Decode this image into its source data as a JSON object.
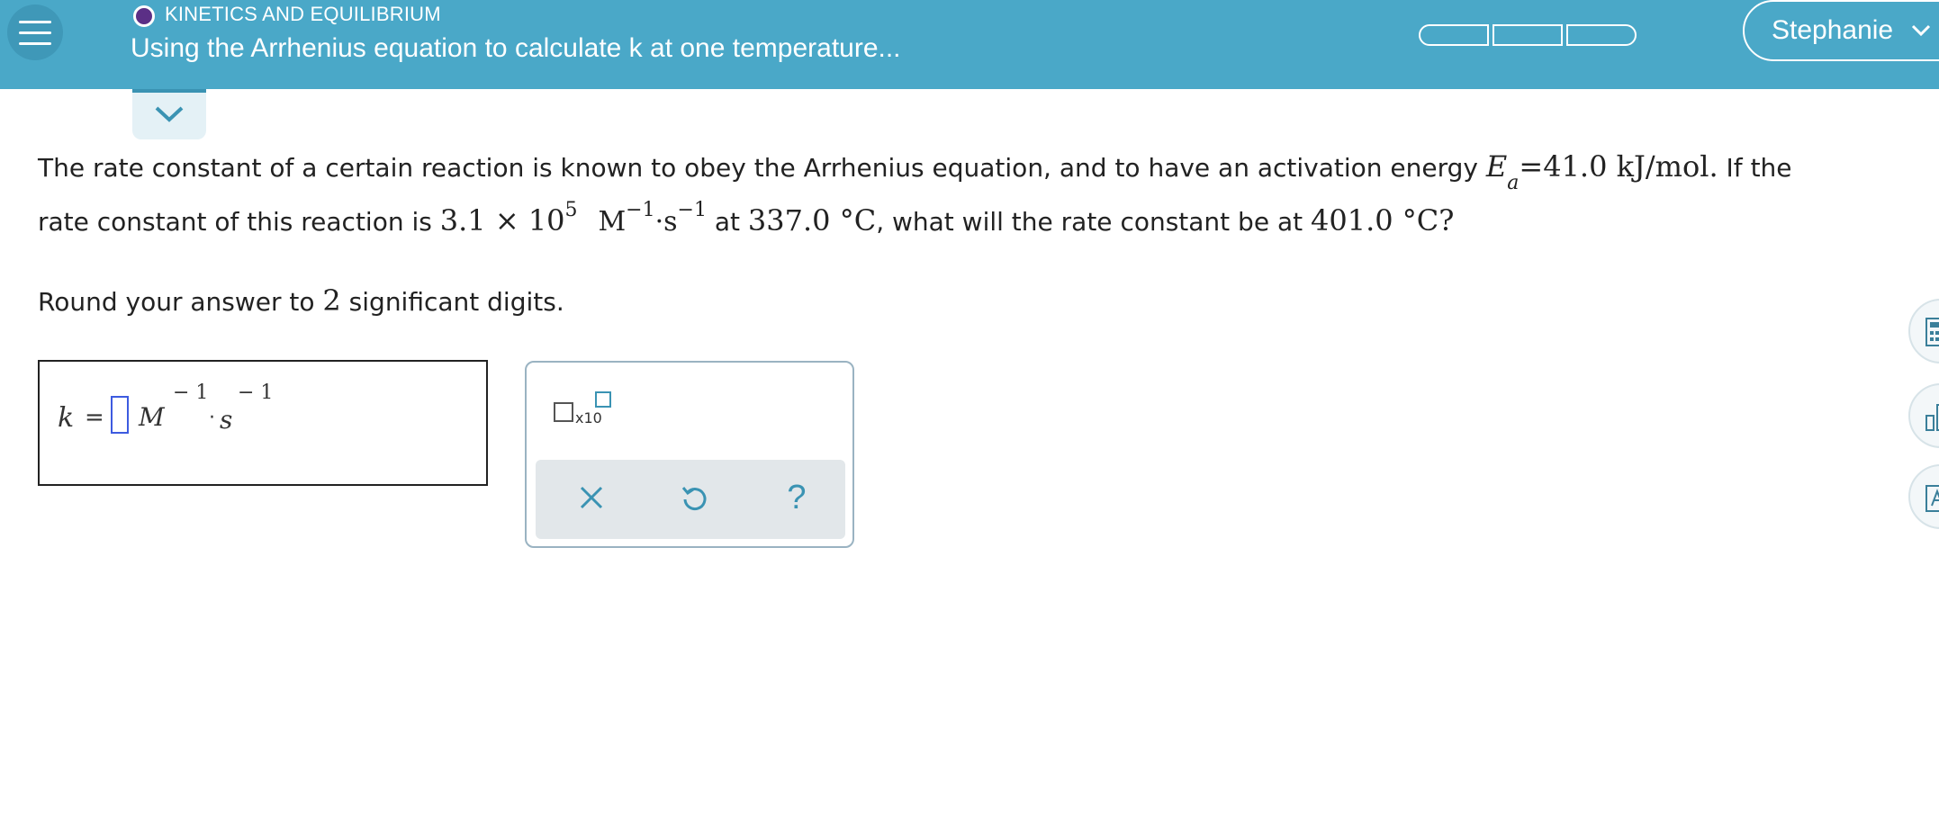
{
  "header": {
    "topic": "KINETICS AND EQUILIBRIUM",
    "title": "Using the Arrhenius equation to calculate k at one temperature...",
    "user": "Stephanie",
    "progress_segments": 3,
    "accent_color": "#4aa8c8",
    "topic_dot_color": "#5b2f86"
  },
  "question": {
    "line1_text": "The rate constant of a certain reaction is known to obey the Arrhenius equation, and to have an activation energy",
    "Ea_symbol": "E",
    "Ea_sub": "a",
    "Ea_value": "=41.0  kJ/mol.",
    "line1_tail": "If the",
    "line2_text": "rate constant of this reaction is",
    "k_mantissa": "3.1 × 10",
    "k_exp": "5",
    "k_unit_M": "M",
    "k_unit_M_exp": "−1",
    "k_unit_s": "·s",
    "k_unit_s_exp": "−1",
    "at": "at",
    "T1": "337.0 °C",
    "line2_mid": ", what will the rate constant be at",
    "T2": "401.0 °C",
    "line2_end": "?",
    "round_text_pre": "Round your answer to",
    "round_digits": "2",
    "round_text_post": "significant digits."
  },
  "answer": {
    "var": "k",
    "eq": "=",
    "unit_M": "M",
    "unit_M_exp": "− 1",
    "dot": "·",
    "unit_s": "s",
    "unit_s_exp": "− 1",
    "input_value": ""
  },
  "tools": {
    "x10_label": "x10",
    "clear_icon": "close-icon",
    "undo_icon": "undo-icon",
    "help_label": "?"
  },
  "side": {
    "icons": [
      "calculator-icon",
      "chart-icon",
      "periodic-table-icon"
    ]
  }
}
